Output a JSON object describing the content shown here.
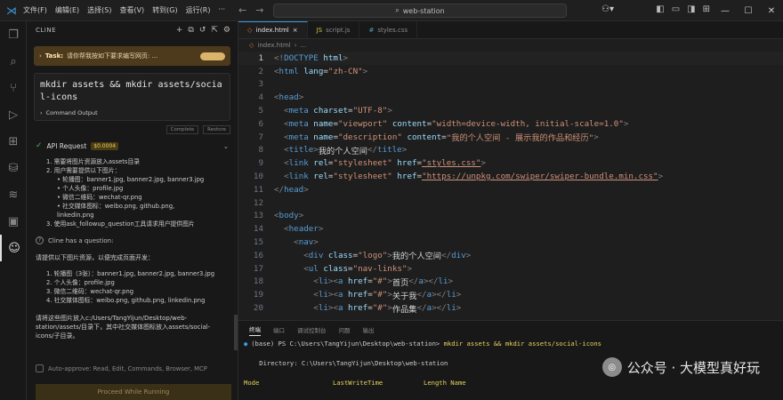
{
  "menu": [
    "文件(F)",
    "编辑(E)",
    "选择(S)",
    "查看(V)",
    "转到(G)",
    "运行(R)",
    "···"
  ],
  "search": {
    "text": "web-station"
  },
  "window": {
    "minimize": "—",
    "maximize": "☐",
    "close": "✕"
  },
  "sidebar": {
    "title": "CLINE",
    "task_label": "Task:",
    "task_text": "请你帮我按如下要求编写网页: ...",
    "command": "mkdir assets && mkdir assets/social-icons",
    "command_output": "Command Output",
    "btn_complete": "Complete",
    "btn_restore": "Restore",
    "api_label": "API Request",
    "api_cost": "$0.0004",
    "steps": [
      "1. 需要将图片资源放入assets目录",
      "2. 用户需要提供以下图片：",
      "• 轮播图：banner1.jpg, banner2.jpg, banner3.jpg",
      "• 个人头像：profile.jpg",
      "• 微信二维码：wechat-qr.png",
      "• 社交媒体图标：weibo.png, github.png,",
      "linkedin.png",
      "3. 使用ask_followup_question工具请求用户提供图片"
    ],
    "followup_label": "Cline has a question:",
    "question_intro": "请提供以下图片资源，以便完成页面开发：",
    "question_items": [
      "1. 轮播图（3张）：banner1.jpg, banner2.jpg, banner3.jpg",
      "2. 个人头像：profile.jpg",
      "3. 微信二维码：wechat-qr.png",
      "4. 社交媒体图标：weibo.png, github.png, linkedin.png"
    ],
    "question_outro": "请将这些图片放入c:/Users/TangYijun/Desktop/web-station/assets/目录下，其中社交媒体图标放入assets/social-icons/子目录。",
    "auto_approve": "Auto-approve: Read, Edit, Commands, Browser, MCP",
    "proceed_button": "Proceed While Running"
  },
  "tabs": [
    {
      "icon": "◇",
      "label": "index.html"
    },
    {
      "icon": "JS",
      "label": "script.js"
    },
    {
      "icon": "#",
      "label": "styles.css"
    }
  ],
  "breadcrumb": {
    "file": "index.html",
    "rest": "..."
  },
  "code_lines": [
    {
      "n": "1",
      "cur": true,
      "parts": [
        [
          "t-br",
          "<!"
        ],
        [
          "t-tag",
          "DOCTYPE"
        ],
        [
          "t-attr",
          " html"
        ],
        [
          "t-br",
          ">"
        ]
      ]
    },
    {
      "n": "2",
      "parts": [
        [
          "t-br",
          "<"
        ],
        [
          "t-tag",
          "html"
        ],
        [
          "t-attr",
          " lang"
        ],
        [
          "t-txt",
          "="
        ],
        [
          "t-str",
          "\"zh-CN\""
        ],
        [
          "t-br",
          ">"
        ]
      ]
    },
    {
      "n": "3",
      "parts": []
    },
    {
      "n": "4",
      "parts": [
        [
          "t-br",
          "<"
        ],
        [
          "t-tag",
          "head"
        ],
        [
          "t-br",
          ">"
        ]
      ]
    },
    {
      "n": "5",
      "parts": [
        [
          "t-txt",
          "  "
        ],
        [
          "t-br",
          "<"
        ],
        [
          "t-tag",
          "meta"
        ],
        [
          "t-attr",
          " charset"
        ],
        [
          "t-txt",
          "="
        ],
        [
          "t-str",
          "\"UTF-8\""
        ],
        [
          "t-br",
          ">"
        ]
      ]
    },
    {
      "n": "6",
      "parts": [
        [
          "t-txt",
          "  "
        ],
        [
          "t-br",
          "<"
        ],
        [
          "t-tag",
          "meta"
        ],
        [
          "t-attr",
          " name"
        ],
        [
          "t-txt",
          "="
        ],
        [
          "t-str",
          "\"viewport\""
        ],
        [
          "t-attr",
          " content"
        ],
        [
          "t-txt",
          "="
        ],
        [
          "t-str",
          "\"width=device-width, initial-scale=1.0\""
        ],
        [
          "t-br",
          ">"
        ]
      ]
    },
    {
      "n": "7",
      "parts": [
        [
          "t-txt",
          "  "
        ],
        [
          "t-br",
          "<"
        ],
        [
          "t-tag",
          "meta"
        ],
        [
          "t-attr",
          " name"
        ],
        [
          "t-txt",
          "="
        ],
        [
          "t-str",
          "\"description\""
        ],
        [
          "t-attr",
          " content"
        ],
        [
          "t-txt",
          "="
        ],
        [
          "t-str",
          "\"我的个人空间 - 展示我的作品和经历\""
        ],
        [
          "t-br",
          ">"
        ]
      ]
    },
    {
      "n": "8",
      "parts": [
        [
          "t-txt",
          "  "
        ],
        [
          "t-br",
          "<"
        ],
        [
          "t-tag",
          "title"
        ],
        [
          "t-br",
          ">"
        ],
        [
          "t-txt",
          "我的个人空间"
        ],
        [
          "t-br",
          "</"
        ],
        [
          "t-tag",
          "title"
        ],
        [
          "t-br",
          ">"
        ]
      ]
    },
    {
      "n": "9",
      "parts": [
        [
          "t-txt",
          "  "
        ],
        [
          "t-br",
          "<"
        ],
        [
          "t-tag",
          "link"
        ],
        [
          "t-attr",
          " rel"
        ],
        [
          "t-txt",
          "="
        ],
        [
          "t-str",
          "\"stylesheet\""
        ],
        [
          "t-attr",
          " href"
        ],
        [
          "t-txt",
          "="
        ],
        [
          "t-str t-und",
          "\"styles.css\""
        ],
        [
          "t-br",
          ">"
        ]
      ]
    },
    {
      "n": "10",
      "parts": [
        [
          "t-txt",
          "  "
        ],
        [
          "t-br",
          "<"
        ],
        [
          "t-tag",
          "link"
        ],
        [
          "t-attr",
          " rel"
        ],
        [
          "t-txt",
          "="
        ],
        [
          "t-str",
          "\"stylesheet\""
        ],
        [
          "t-attr",
          " href"
        ],
        [
          "t-txt",
          "="
        ],
        [
          "t-str t-und",
          "\"https://unpkg.com/swiper/swiper-bundle.min.css\""
        ],
        [
          "t-br",
          ">"
        ]
      ]
    },
    {
      "n": "11",
      "parts": [
        [
          "t-br",
          "</"
        ],
        [
          "t-tag",
          "head"
        ],
        [
          "t-br",
          ">"
        ]
      ]
    },
    {
      "n": "12",
      "parts": []
    },
    {
      "n": "13",
      "parts": [
        [
          "t-br",
          "<"
        ],
        [
          "t-tag",
          "body"
        ],
        [
          "t-br",
          ">"
        ]
      ]
    },
    {
      "n": "14",
      "parts": [
        [
          "t-txt",
          "  "
        ],
        [
          "t-br",
          "<"
        ],
        [
          "t-tag",
          "header"
        ],
        [
          "t-br",
          ">"
        ]
      ]
    },
    {
      "n": "15",
      "parts": [
        [
          "t-txt",
          "    "
        ],
        [
          "t-br",
          "<"
        ],
        [
          "t-tag",
          "nav"
        ],
        [
          "t-br",
          ">"
        ]
      ]
    },
    {
      "n": "16",
      "parts": [
        [
          "t-txt",
          "      "
        ],
        [
          "t-br",
          "<"
        ],
        [
          "t-tag",
          "div"
        ],
        [
          "t-attr",
          " class"
        ],
        [
          "t-txt",
          "="
        ],
        [
          "t-str",
          "\"logo\""
        ],
        [
          "t-br",
          ">"
        ],
        [
          "t-txt",
          "我的个人空间"
        ],
        [
          "t-br",
          "</"
        ],
        [
          "t-tag",
          "div"
        ],
        [
          "t-br",
          ">"
        ]
      ]
    },
    {
      "n": "17",
      "parts": [
        [
          "t-txt",
          "      "
        ],
        [
          "t-br",
          "<"
        ],
        [
          "t-tag",
          "ul"
        ],
        [
          "t-attr",
          " class"
        ],
        [
          "t-txt",
          "="
        ],
        [
          "t-str",
          "\"nav-links\""
        ],
        [
          "t-br",
          ">"
        ]
      ]
    },
    {
      "n": "18",
      "parts": [
        [
          "t-txt",
          "        "
        ],
        [
          "t-br",
          "<"
        ],
        [
          "t-tag",
          "li"
        ],
        [
          "t-br",
          "><"
        ],
        [
          "t-tag",
          "a"
        ],
        [
          "t-attr",
          " href"
        ],
        [
          "t-txt",
          "="
        ],
        [
          "t-str",
          "\"#\""
        ],
        [
          "t-br",
          ">"
        ],
        [
          "t-txt",
          "首页"
        ],
        [
          "t-br",
          "</"
        ],
        [
          "t-tag",
          "a"
        ],
        [
          "t-br",
          "></"
        ],
        [
          "t-tag",
          "li"
        ],
        [
          "t-br",
          ">"
        ]
      ]
    },
    {
      "n": "19",
      "parts": [
        [
          "t-txt",
          "        "
        ],
        [
          "t-br",
          "<"
        ],
        [
          "t-tag",
          "li"
        ],
        [
          "t-br",
          "><"
        ],
        [
          "t-tag",
          "a"
        ],
        [
          "t-attr",
          " href"
        ],
        [
          "t-txt",
          "="
        ],
        [
          "t-str",
          "\"#\""
        ],
        [
          "t-br",
          ">"
        ],
        [
          "t-txt",
          "关于我"
        ],
        [
          "t-br",
          "</"
        ],
        [
          "t-tag",
          "a"
        ],
        [
          "t-br",
          "></"
        ],
        [
          "t-tag",
          "li"
        ],
        [
          "t-br",
          ">"
        ]
      ]
    },
    {
      "n": "20",
      "parts": [
        [
          "t-txt",
          "        "
        ],
        [
          "t-br",
          "<"
        ],
        [
          "t-tag",
          "li"
        ],
        [
          "t-br",
          "><"
        ],
        [
          "t-tag",
          "a"
        ],
        [
          "t-attr",
          " href"
        ],
        [
          "t-txt",
          "="
        ],
        [
          "t-str",
          "\"#\""
        ],
        [
          "t-br",
          ">"
        ],
        [
          "t-txt",
          "作品集"
        ],
        [
          "t-br",
          "</"
        ],
        [
          "t-tag",
          "a"
        ],
        [
          "t-br",
          "></"
        ],
        [
          "t-tag",
          "li"
        ],
        [
          "t-br",
          ">"
        ]
      ]
    }
  ],
  "panel": {
    "tabs": [
      "终端",
      "端口",
      "调试控制台",
      "问题",
      "输出"
    ],
    "prompt": "(base) PS C:\\Users\\TangYijun\\Desktop\\web-station>",
    "command": " mkdir assets && mkdir assets/social-icons",
    "directory": "    Directory: C:\\Users\\TangYijun\\Desktop\\web-station",
    "headers": [
      "Mode",
      "LastWriteTime",
      "Length Name"
    ]
  },
  "watermark": "公众号 · 大模型真好玩"
}
